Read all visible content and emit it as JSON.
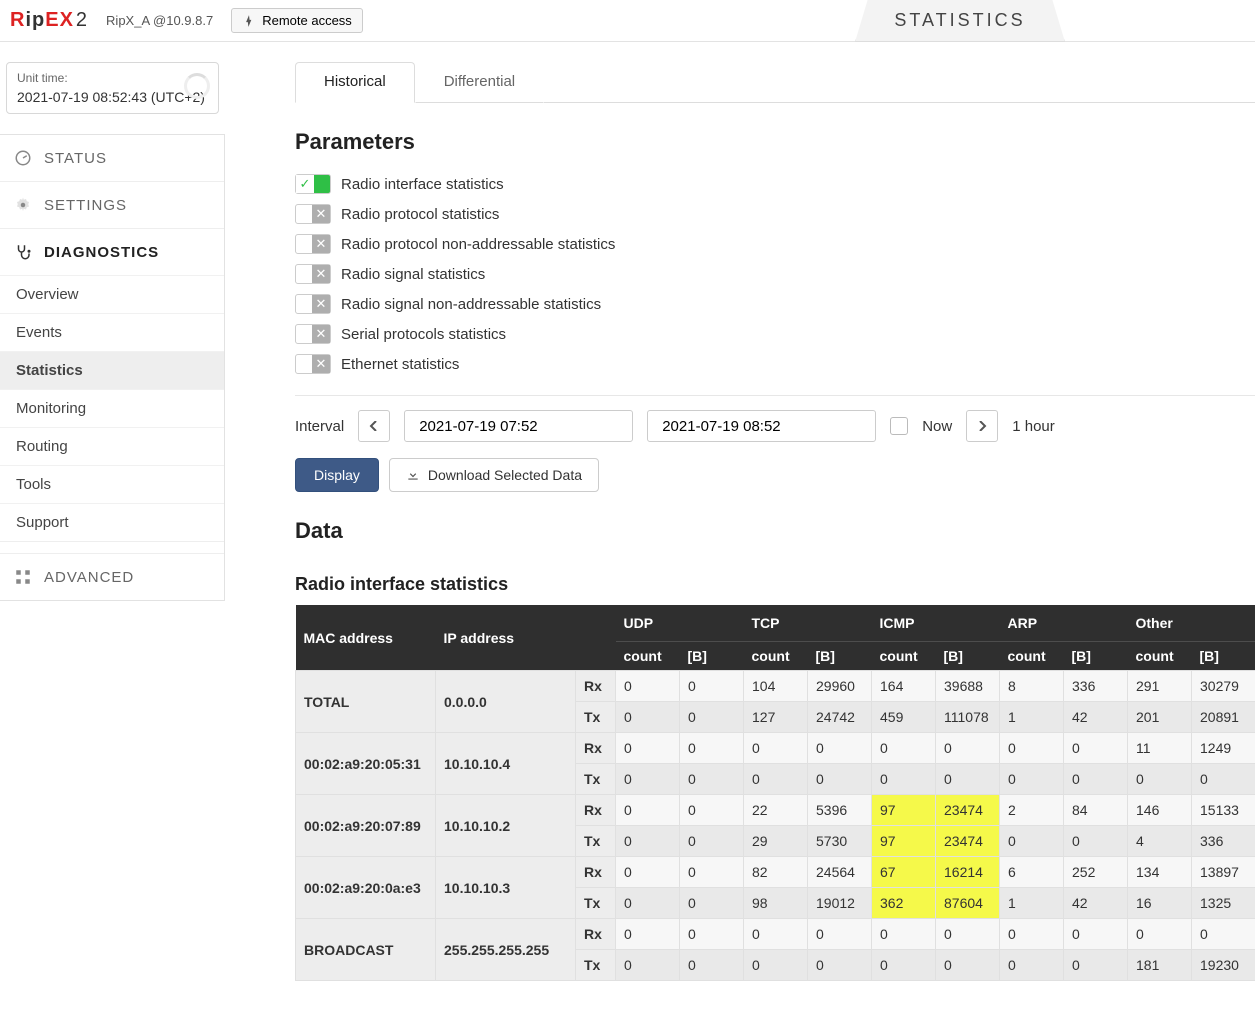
{
  "header": {
    "logo_parts": {
      "r": "R",
      "ip": "ip",
      "ex": "EX",
      "two": "2"
    },
    "unit": "RipX_A @10.9.8.7",
    "remote": "Remote access",
    "page_tab": "STATISTICS"
  },
  "unit_time": {
    "label": "Unit time:",
    "value": "2021-07-19 08:52:43 (UTC+2)"
  },
  "nav": {
    "status": "STATUS",
    "settings": "SETTINGS",
    "diagnostics": "DIAGNOSTICS",
    "advanced": "ADVANCED",
    "subs": {
      "overview": "Overview",
      "events": "Events",
      "statistics": "Statistics",
      "monitoring": "Monitoring",
      "routing": "Routing",
      "tools": "Tools",
      "support": "Support"
    }
  },
  "tabs": {
    "historical": "Historical",
    "differential": "Differential"
  },
  "sections": {
    "parameters": "Parameters",
    "data": "Data",
    "ris": "Radio interface statistics"
  },
  "params": {
    "p0": "Radio interface statistics",
    "p1": "Radio protocol statistics",
    "p2": "Radio protocol non-addressable statistics",
    "p3": "Radio signal statistics",
    "p4": "Radio signal non-addressable statistics",
    "p5": "Serial protocols statistics",
    "p6": "Ethernet statistics"
  },
  "interval": {
    "label": "Interval",
    "from": "2021-07-19 07:52",
    "to": "2021-07-19 08:52",
    "now": "Now",
    "span": "1 hour"
  },
  "actions": {
    "display": "Display",
    "download": "Download Selected Data"
  },
  "table": {
    "headers": {
      "mac": "MAC address",
      "ip": "IP address",
      "udp": "UDP",
      "tcp": "TCP",
      "icmp": "ICMP",
      "arp": "ARP",
      "other": "Other",
      "count": "count",
      "bytes": "[B]",
      "rx": "Rx",
      "tx": "Tx"
    },
    "rows": [
      {
        "mac": "TOTAL",
        "ip": "0.0.0.0",
        "rx": {
          "udp_c": "0",
          "udp_b": "0",
          "tcp_c": "104",
          "tcp_b": "29960",
          "icmp_c": "164",
          "icmp_b": "39688",
          "arp_c": "8",
          "arp_b": "336",
          "oth_c": "291",
          "oth_b": "30279"
        },
        "tx": {
          "udp_c": "0",
          "udp_b": "0",
          "tcp_c": "127",
          "tcp_b": "24742",
          "icmp_c": "459",
          "icmp_b": "111078",
          "arp_c": "1",
          "arp_b": "42",
          "oth_c": "201",
          "oth_b": "20891"
        }
      },
      {
        "mac": "00:02:a9:20:05:31",
        "ip": "10.10.10.4",
        "rx": {
          "udp_c": "0",
          "udp_b": "0",
          "tcp_c": "0",
          "tcp_b": "0",
          "icmp_c": "0",
          "icmp_b": "0",
          "arp_c": "0",
          "arp_b": "0",
          "oth_c": "11",
          "oth_b": "1249"
        },
        "tx": {
          "udp_c": "0",
          "udp_b": "0",
          "tcp_c": "0",
          "tcp_b": "0",
          "icmp_c": "0",
          "icmp_b": "0",
          "arp_c": "0",
          "arp_b": "0",
          "oth_c": "0",
          "oth_b": "0"
        }
      },
      {
        "mac": "00:02:a9:20:07:89",
        "ip": "10.10.10.2",
        "rx": {
          "udp_c": "0",
          "udp_b": "0",
          "tcp_c": "22",
          "tcp_b": "5396",
          "icmp_c": "97",
          "icmp_b": "23474",
          "arp_c": "2",
          "arp_b": "84",
          "oth_c": "146",
          "oth_b": "15133"
        },
        "tx": {
          "udp_c": "0",
          "udp_b": "0",
          "tcp_c": "29",
          "tcp_b": "5730",
          "icmp_c": "97",
          "icmp_b": "23474",
          "arp_c": "0",
          "arp_b": "0",
          "oth_c": "4",
          "oth_b": "336"
        },
        "hl_rx": [
          "icmp_c",
          "icmp_b"
        ],
        "hl_tx": [
          "icmp_c",
          "icmp_b"
        ]
      },
      {
        "mac": "00:02:a9:20:0a:e3",
        "ip": "10.10.10.3",
        "rx": {
          "udp_c": "0",
          "udp_b": "0",
          "tcp_c": "82",
          "tcp_b": "24564",
          "icmp_c": "67",
          "icmp_b": "16214",
          "arp_c": "6",
          "arp_b": "252",
          "oth_c": "134",
          "oth_b": "13897"
        },
        "tx": {
          "udp_c": "0",
          "udp_b": "0",
          "tcp_c": "98",
          "tcp_b": "19012",
          "icmp_c": "362",
          "icmp_b": "87604",
          "arp_c": "1",
          "arp_b": "42",
          "oth_c": "16",
          "oth_b": "1325"
        },
        "hl_rx": [
          "icmp_c",
          "icmp_b"
        ],
        "hl_tx": [
          "icmp_c",
          "icmp_b"
        ]
      },
      {
        "mac": "BROADCAST",
        "ip": "255.255.255.255",
        "rx": {
          "udp_c": "0",
          "udp_b": "0",
          "tcp_c": "0",
          "tcp_b": "0",
          "icmp_c": "0",
          "icmp_b": "0",
          "arp_c": "0",
          "arp_b": "0",
          "oth_c": "0",
          "oth_b": "0"
        },
        "tx": {
          "udp_c": "0",
          "udp_b": "0",
          "tcp_c": "0",
          "tcp_b": "0",
          "icmp_c": "0",
          "icmp_b": "0",
          "arp_c": "0",
          "arp_b": "0",
          "oth_c": "181",
          "oth_b": "19230"
        }
      }
    ]
  }
}
